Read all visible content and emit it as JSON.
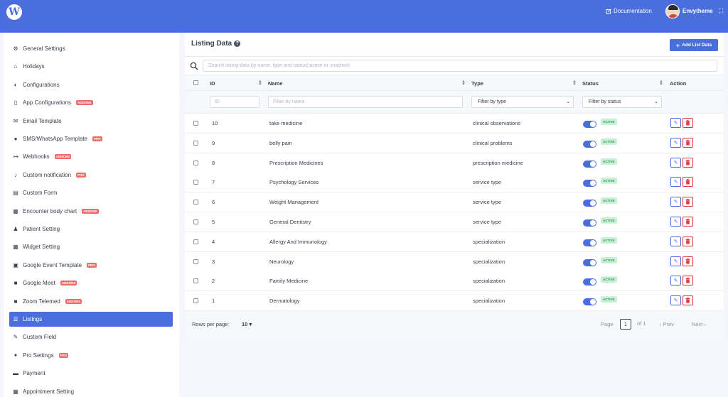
{
  "header": {
    "documentation_label": "Documentation",
    "username": "Envytheme"
  },
  "sidebar": {
    "items": [
      {
        "label": "General Settings",
        "icon": "gears-icon",
        "badge": ""
      },
      {
        "label": "Holidays",
        "icon": "home-icon",
        "badge": ""
      },
      {
        "label": "Configurations",
        "icon": "toggle-icon",
        "badge": ""
      },
      {
        "label": "App Configurations",
        "icon": "mobile-icon",
        "badge": "ADDONS"
      },
      {
        "label": "Email Template",
        "icon": "envelope-icon",
        "badge": ""
      },
      {
        "label": "SMS/WhatsApp Template",
        "icon": "chat-bubble-icon",
        "badge": "PRO"
      },
      {
        "label": "Webhooks",
        "icon": "webhook-icon",
        "badge": "ADDONS"
      },
      {
        "label": "Custom notification",
        "icon": "bell-icon",
        "badge": "PRO"
      },
      {
        "label": "Custom Form",
        "icon": "form-icon",
        "badge": ""
      },
      {
        "label": "Encounter body chart",
        "icon": "body-chart-icon",
        "badge": "ADDONS"
      },
      {
        "label": "Patient Setting",
        "icon": "user-icon",
        "badge": ""
      },
      {
        "label": "Widget Setting",
        "icon": "calendar-icon",
        "badge": ""
      },
      {
        "label": "Google Event Template",
        "icon": "google-calendar-icon",
        "badge": "PRO"
      },
      {
        "label": "Google Meet",
        "icon": "video-icon",
        "badge": "ADDONS"
      },
      {
        "label": "Zoom Telemed",
        "icon": "video-icon",
        "badge": "ADDONS"
      },
      {
        "label": "Listings",
        "icon": "list-icon",
        "badge": ""
      },
      {
        "label": "Custom Field",
        "icon": "magic-wand-icon",
        "badge": ""
      },
      {
        "label": "Pro Settings",
        "icon": "wrench-icon",
        "badge": "PRO"
      },
      {
        "label": "Payment",
        "icon": "card-icon",
        "badge": ""
      },
      {
        "label": "Appointment Setting",
        "icon": "calendar-icon",
        "badge": ""
      }
    ],
    "active_index": 15
  },
  "panel": {
    "title": "Listing Data",
    "add_button_label": "Add List Data",
    "search_placeholder": "Search listing-data by name, type and status(:active or :inactive)"
  },
  "table": {
    "columns": [
      "ID",
      "Name",
      "Type",
      "Status",
      "Action"
    ],
    "filters": {
      "id_placeholder": "ID",
      "name_placeholder": "Filter by name",
      "type_placeholder": "Filter by type",
      "status_placeholder": "Filter by status"
    },
    "rows": [
      {
        "id": "10",
        "name": "take medicine",
        "type": "clinical observations",
        "status": "ACTIVE"
      },
      {
        "id": "9",
        "name": "belly pain",
        "type": "clinical problems",
        "status": "ACTIVE"
      },
      {
        "id": "8",
        "name": "Prescription Medicines",
        "type": "prescription medicine",
        "status": "ACTIVE"
      },
      {
        "id": "7",
        "name": "Psychology Services",
        "type": "service type",
        "status": "ACTIVE"
      },
      {
        "id": "6",
        "name": "Weight Management",
        "type": "service type",
        "status": "ACTIVE"
      },
      {
        "id": "5",
        "name": "General Dentistry",
        "type": "service type",
        "status": "ACTIVE"
      },
      {
        "id": "4",
        "name": "Allergy And Immunology",
        "type": "specialization",
        "status": "ACTIVE"
      },
      {
        "id": "3",
        "name": "Neurology",
        "type": "specialization",
        "status": "ACTIVE"
      },
      {
        "id": "2",
        "name": "Family Medicine",
        "type": "specialization",
        "status": "ACTIVE"
      },
      {
        "id": "1",
        "name": "Dermatology",
        "type": "specialization",
        "status": "ACTIVE"
      }
    ]
  },
  "pagination": {
    "rows_per_page_label": "Rows per page:",
    "rows_per_page_value": "10",
    "page_label": "Page",
    "current_page": "1",
    "of_label": "of 1",
    "prev_label": "Prev",
    "next_label": "Next"
  },
  "colors": {
    "primary": "#4a6fdc",
    "danger": "#e23b3b",
    "badge": "#f16a6a",
    "active_badge_bg": "#c9f0d6",
    "active_badge_text": "#2e9e5a"
  }
}
